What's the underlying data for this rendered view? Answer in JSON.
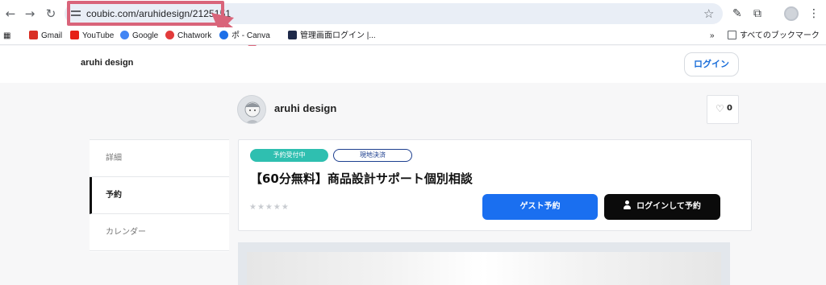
{
  "browser": {
    "url": "coubic.com/aruhidesign/2125151",
    "bookmarks": [
      {
        "label": "Gmail",
        "icon": "gmail-icon",
        "color": "#d93025"
      },
      {
        "label": "YouTube",
        "icon": "youtube-icon",
        "color": "#e62117"
      },
      {
        "label": "Google",
        "icon": "google-icon",
        "color": "#4285f4"
      },
      {
        "label": "Chatwork",
        "icon": "chatwork-icon",
        "color": "#e23b3b"
      },
      {
        "label": "ポ - Canva",
        "icon": "canva-icon",
        "color": "#1d6fe8"
      },
      {
        "label": "管理画面ログイン |...",
        "icon": "lv-icon",
        "color": "#1f2a4a"
      }
    ],
    "bookmarks_overflow": "»",
    "all_bookmarks": "すべてのブックマーク",
    "highlight_color": "#d9647a"
  },
  "header": {
    "site_name": "aruhi design",
    "login_label": "ログイン"
  },
  "profile": {
    "name": "aruhi design",
    "likes": "0"
  },
  "sidebar": {
    "items": [
      {
        "label": "詳細",
        "active": false
      },
      {
        "label": "予約",
        "active": true
      },
      {
        "label": "カレンダー",
        "active": false
      }
    ]
  },
  "service": {
    "badge_accepting": "予約受付中",
    "badge_payment": "現地決済",
    "title": "【60分無料】商品設計サポート個別相談",
    "stars": "★★★★★",
    "guest_button": "ゲスト予約",
    "login_reserve_button": "ログインして予約"
  },
  "colors": {
    "primary": "#1a6ff0",
    "teal": "#2fbfb0",
    "navy": "#1d3f8f"
  }
}
